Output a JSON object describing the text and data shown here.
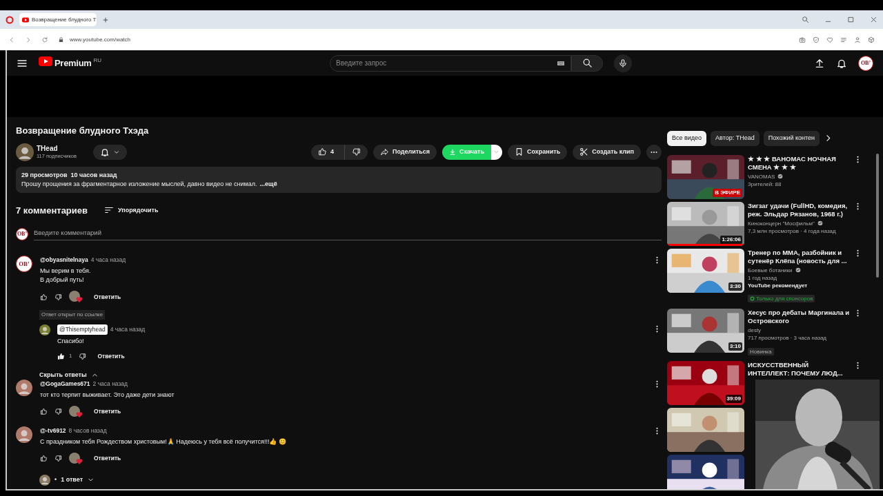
{
  "browser": {
    "tab_title": "Возвращение блудного Т",
    "url": "www.youtube.com/watch"
  },
  "header": {
    "logo": "Premium",
    "region": "RU",
    "search_placeholder": "Введите запрос",
    "avatar": "OB’"
  },
  "video": {
    "title": "Возвращение блудного Тхэда",
    "channel": "THead",
    "subscribers": "117 подписчиков",
    "likes": "4",
    "actions": [
      {
        "kind": "share",
        "label": "Поделиться"
      },
      {
        "kind": "download",
        "label": "Скачать"
      },
      {
        "kind": "save",
        "label": "Сохранить"
      },
      {
        "kind": "clip",
        "label": "Создать клип"
      }
    ],
    "stats": "29 просмотров  10 часов назад",
    "description": "Прошу прощения за фрагментарное изложение мыслей, давно видео не снимал.",
    "more": "...ещё"
  },
  "comments": {
    "count": "7 комментариев",
    "sort": "Упорядочить",
    "input_placeholder": "Введите комментарий",
    "avatar": "OB’",
    "items": [
      {
        "author": "@obyasnitelnaya",
        "avatar": "OB’",
        "time": "4 часа назад",
        "lines": [
          "Мы верим в тебя.",
          "В добрый путь!"
        ],
        "liked": false,
        "hearted": true,
        "reply": "Ответить",
        "thread": {
          "note": "Ответ открыт по ссылке",
          "expanded": true,
          "toggle": "Скрыть ответы",
          "replies": [
            {
              "author": "@Thisemptyhead",
              "highlighted": true,
              "time": "4 часа назад",
              "lines": [
                "Спасибо!"
              ],
              "liked": true,
              "likes": "1",
              "hearted": false,
              "reply": "Ответить"
            }
          ]
        }
      },
      {
        "author": "@GogaGames671",
        "time": "2 часа назад",
        "lines": [
          "тот кто терпит выживает. Это даже дети знают"
        ],
        "liked": false,
        "hearted": true,
        "reply": "Ответить"
      },
      {
        "author": "@-tv6912",
        "time": "8 часов назад",
        "lines": [
          "С праздником тебя Рождеством христовым!🙏 Надеюсь у тебя всё получится!!!👍 😊"
        ],
        "liked": false,
        "hearted": true,
        "reply": "Ответить",
        "thread": {
          "expanded": false,
          "bullet": "•",
          "toggle": "1 ответ"
        }
      }
    ]
  },
  "sidebar": {
    "chips": [
      {
        "label": "Все видео",
        "selected": true
      },
      {
        "label": "Автор: THead",
        "selected": false
      },
      {
        "label": "Похожий контен",
        "selected": false
      }
    ],
    "videos": [
      {
        "kind": "video",
        "title": "★ ★ ★ ВАНОМАС НОЧНАЯ СМЕНА ★ ★ ★",
        "channel": "VANOMAS",
        "verified": true,
        "meta": [
          "Зрителей: 88"
        ],
        "live": "В ЭФИРЕ"
      },
      {
        "kind": "video",
        "title": "Зигзаг удачи (FullHD, комедия, реж. Эльдар Рязанов, 1968 г.)",
        "channel": "Киноконцерн \"Мосфильм\"",
        "verified": true,
        "meta": [
          "7,3 млн просмотров · 4 года назад"
        ],
        "duration": "1:26:06",
        "progress": {
          "level": 1
        }
      },
      {
        "kind": "video",
        "title": "Тренер по ММА, разбойник и сутенёр Клёпа (новость для ...",
        "channel": "Боевые ботаники",
        "verified": true,
        "meta": [
          "1 год назад"
        ],
        "note": "YouTube рекомендует",
        "badge": {
          "kind": "members",
          "label": "Только для спонсоров"
        },
        "duration": "3:30"
      },
      {
        "kind": "video",
        "title": "Хесус про дебаты Маргинала и Островского",
        "channel": "desty",
        "verified": false,
        "meta": [
          "717 просмотров · 3 часа назад"
        ],
        "badge": {
          "kind": "new",
          "label": "Новинка"
        },
        "duration": "3:10"
      },
      {
        "kind": "video",
        "title": "ИСКУССТВЕННЫЙ ИНТЕЛЛЕКТ: ПОЧЕМУ ЛЮД...",
        "duration": "39:09"
      },
      {
        "kind": "thumbnail"
      },
      {
        "kind": "thumbnail"
      }
    ]
  }
}
